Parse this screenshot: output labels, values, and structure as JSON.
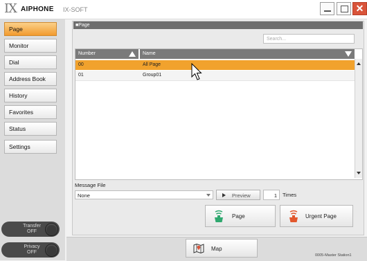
{
  "window": {
    "logo_mark": "IX",
    "brand": "AIPHONE",
    "product": "IX-SOFT",
    "close_glyph": "✕"
  },
  "sidebar": {
    "items": [
      {
        "label": "Page",
        "active": true
      },
      {
        "label": "Monitor",
        "active": false
      },
      {
        "label": "Dial",
        "active": false
      },
      {
        "label": "Address Book",
        "active": false
      },
      {
        "label": "History",
        "active": false
      },
      {
        "label": "Favorites",
        "active": false
      },
      {
        "label": "Status",
        "active": false
      },
      {
        "label": "Settings",
        "active": false
      }
    ],
    "transfer": {
      "label": "Transfer",
      "state": "OFF"
    },
    "privacy": {
      "label": "Privacy",
      "state": "OFF"
    }
  },
  "main": {
    "section_title": "■Page",
    "search_placeholder": "Search...",
    "table": {
      "columns": [
        "Number",
        "Name"
      ],
      "rows": [
        {
          "number": "00",
          "name": "All Page",
          "selected": true
        },
        {
          "number": "01",
          "name": "Group01",
          "selected": false
        }
      ]
    },
    "message_file": {
      "label": "Message File",
      "value": "None",
      "preview_label": "Preview",
      "times_value": "1",
      "times_label": "Times"
    },
    "actions": {
      "page_label": "Page",
      "urgent_label": "Urgent Page"
    }
  },
  "footer": {
    "map_label": "Map",
    "station_text": "0005-Master Station1"
  },
  "colors": {
    "accent": "#f1a22d",
    "page_icon": "#2fa86f",
    "urgent_icon": "#e2572d"
  }
}
